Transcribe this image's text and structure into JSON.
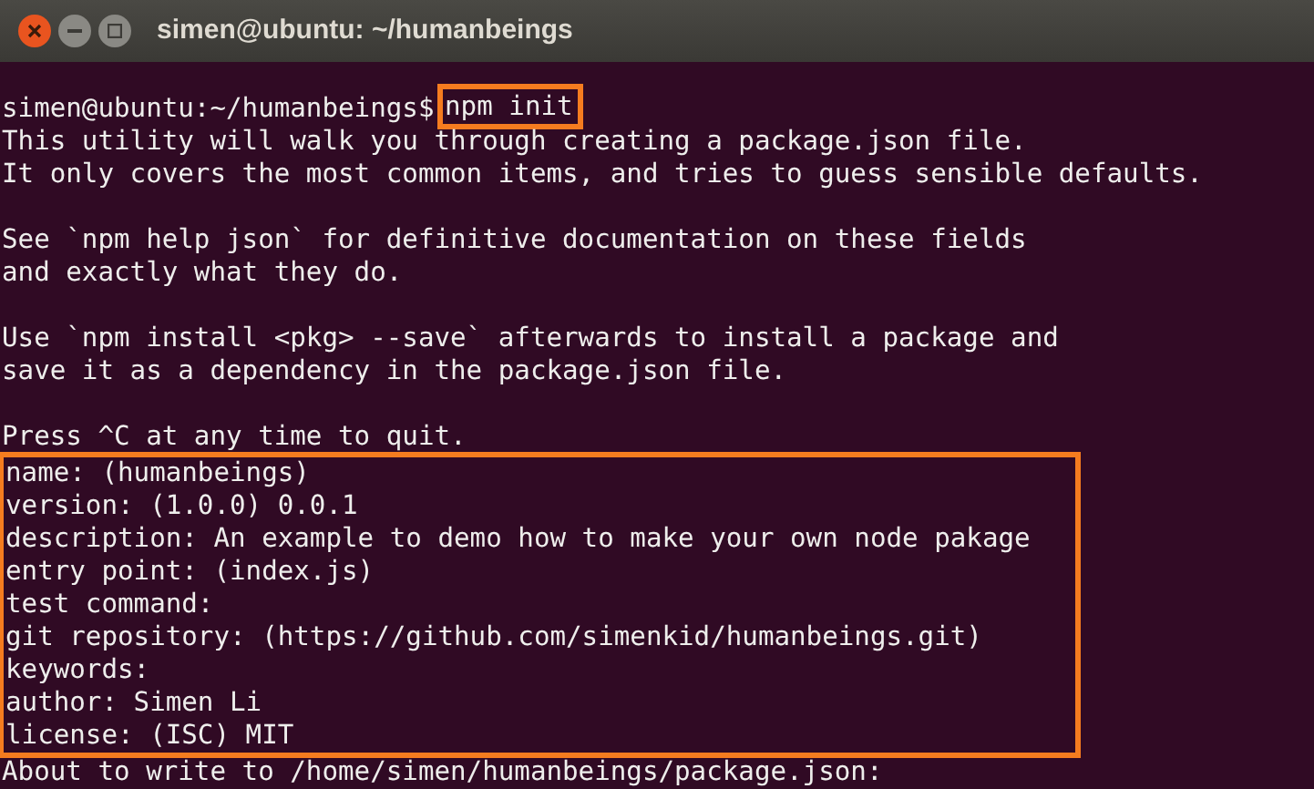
{
  "window": {
    "title": "simen@ubuntu: ~/humanbeings"
  },
  "terminal": {
    "prompt": "simen@ubuntu:~/humanbeings$",
    "command": {
      "text": "npm init",
      "highlighted": true
    },
    "paragraphs": [
      [
        "This utility will walk you through creating a package.json file.",
        "It only covers the most common items, and tries to guess sensible defaults."
      ],
      [
        "See `npm help json` for definitive documentation on these fields",
        "and exactly what they do."
      ],
      [
        "Use `npm install <pkg> --save` afterwards to install a package and",
        "save it as a dependency in the package.json file."
      ],
      [
        "Press ^C at any time to quit."
      ]
    ],
    "answers": {
      "highlighted": true,
      "lines": [
        "name: (humanbeings)",
        "version: (1.0.0) 0.0.1",
        "description: An example to demo how to make your own node pakage",
        "entry point: (index.js)",
        "test command:",
        "git repository: (https://github.com/simenkid/humanbeings.git)",
        "keywords:",
        "author: Simen Li",
        "license: (ISC) MIT"
      ]
    },
    "after": [
      "About to write to /home/simen/humanbeings/package.json:"
    ]
  }
}
